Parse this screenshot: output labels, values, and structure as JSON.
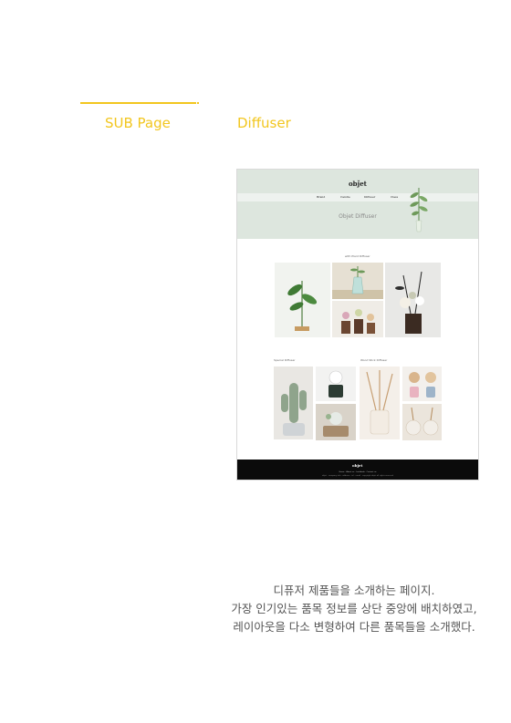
{
  "labels": {
    "section": "SUB Page",
    "page_name": "Diffuser"
  },
  "mockup": {
    "logo": "obǰet",
    "nav": [
      "Brand",
      "Candle",
      "Diffuser",
      "Class"
    ],
    "hero_title": "Objet Diffuser",
    "section_titles": {
      "main": "with Plant Diffuser",
      "left": "Special Diffuser",
      "right": "Wood Stick Diffuser"
    },
    "footer_logo": "objet",
    "footer_nav": "Home · About us · Lookbook · Contact us",
    "footer_info": "objet · company info · address · tel · email · copyright objet all rights reserved"
  },
  "description": [
    "디퓨저 제품들을 소개하는 페이지.",
    "가장 인기있는 품목 정보를  상단 중앙에 배치하였고,",
    "레이아웃을 다소 변형하여 다른 품목들을 소개했다."
  ],
  "colors": {
    "accent": "#f2c61e",
    "hero_bg": "#dde6de",
    "footer_bg": "#0b0b0b"
  }
}
